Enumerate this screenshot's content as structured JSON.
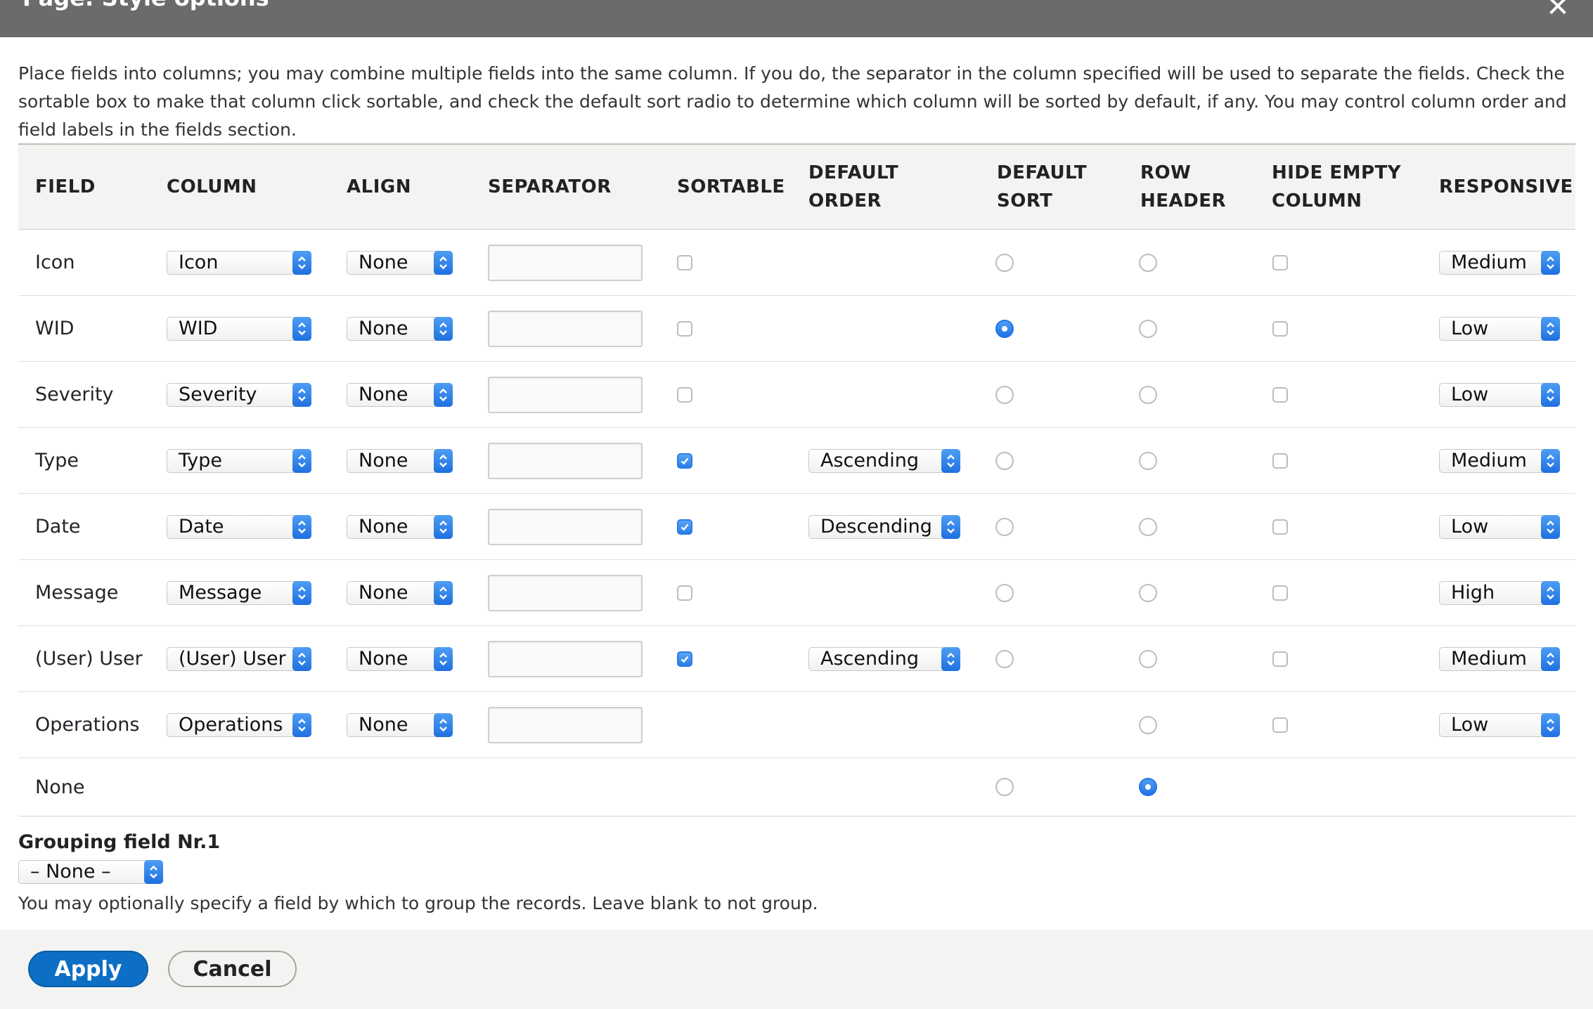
{
  "dialog": {
    "title": "Page: Style options"
  },
  "intro": "Place fields into columns; you may combine multiple fields into the same column. If you do, the separator in the column specified will be used to separate the fields. Check the sortable box to make that column click sortable, and check the default sort radio to determine which column will be sorted by default, if any. You may control column order and field labels in the fields section.",
  "columns": {
    "field": "FIELD",
    "column": "COLUMN",
    "align": "ALIGN",
    "separator": "SEPARATOR",
    "sortable": "SORTABLE",
    "default_order_1": "DEFAULT",
    "default_order_2": "ORDER",
    "default_sort_1": "DEFAULT",
    "default_sort_2": "SORT",
    "row_header_1": "ROW",
    "row_header_2": "HEADER",
    "hide_empty_1": "HIDE EMPTY",
    "hide_empty_2": "COLUMN",
    "responsive": "RESPONSIVE"
  },
  "rows": [
    {
      "field": "Icon",
      "column": "Icon",
      "align": "None",
      "separator": "",
      "sortable": false,
      "default_order": null,
      "default_sort": false,
      "row_header": false,
      "hide_empty": false,
      "responsive": "Medium"
    },
    {
      "field": "WID",
      "column": "WID",
      "align": "None",
      "separator": "",
      "sortable": false,
      "default_order": null,
      "default_sort": true,
      "row_header": false,
      "hide_empty": false,
      "responsive": "Low"
    },
    {
      "field": "Severity",
      "column": "Severity",
      "align": "None",
      "separator": "",
      "sortable": false,
      "default_order": null,
      "default_sort": false,
      "row_header": false,
      "hide_empty": false,
      "responsive": "Low"
    },
    {
      "field": "Type",
      "column": "Type",
      "align": "None",
      "separator": "",
      "sortable": true,
      "default_order": "Ascending",
      "default_sort": false,
      "row_header": false,
      "hide_empty": false,
      "responsive": "Medium"
    },
    {
      "field": "Date",
      "column": "Date",
      "align": "None",
      "separator": "",
      "sortable": true,
      "default_order": "Descending",
      "default_sort": false,
      "row_header": false,
      "hide_empty": false,
      "responsive": "Low"
    },
    {
      "field": "Message",
      "column": "Message",
      "align": "None",
      "separator": "",
      "sortable": false,
      "default_order": null,
      "default_sort": false,
      "row_header": false,
      "hide_empty": false,
      "responsive": "High"
    },
    {
      "field": "(User) User",
      "column": "(User) User",
      "align": "None",
      "separator": "",
      "sortable": true,
      "default_order": "Ascending",
      "default_sort": false,
      "row_header": false,
      "hide_empty": false,
      "responsive": "Medium"
    },
    {
      "field": "Operations",
      "column": "Operations",
      "align": "None",
      "separator": "",
      "sortable": null,
      "default_order": null,
      "default_sort": null,
      "row_header": false,
      "hide_empty": false,
      "responsive": "Low"
    }
  ],
  "none_row": {
    "field": "None",
    "default_sort": false,
    "row_header": true
  },
  "grouping": {
    "label": "Grouping field Nr.1",
    "value": "– None –",
    "description": "You may optionally specify a field by which to group the records. Leave blank to not group."
  },
  "buttons": {
    "apply": "Apply",
    "cancel": "Cancel"
  },
  "colors": {
    "titlebar": "#6b6b6b",
    "accent": "#1f70e0",
    "apply_button": "#0d6ec5",
    "footer": "#f3f3f1"
  }
}
